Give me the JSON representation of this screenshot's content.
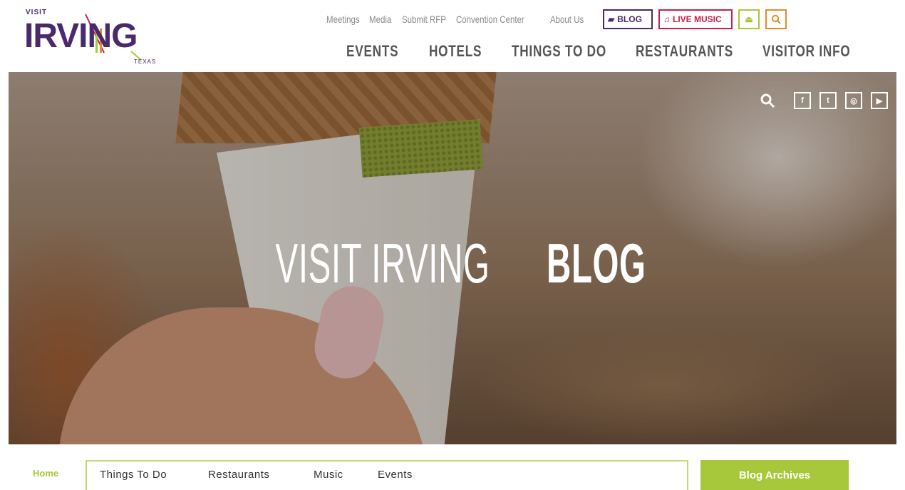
{
  "header": {
    "logo": {
      "visit": "VISIT",
      "word": "IRVING",
      "texas": "TEXAS"
    },
    "utility_links": [
      "Meetings",
      "Media",
      "Submit RFP",
      "Convention Center",
      "About Us"
    ],
    "blog_button": "BLOG",
    "live_music_button": "LIVE MUSIC",
    "main_nav": [
      "EVENTS",
      "HOTELS",
      "THINGS TO DO",
      "RESTAURANTS",
      "VISITOR INFO"
    ],
    "colors": {
      "purple": "#4a2a6b",
      "red": "#c8204b",
      "green": "#a7c83a",
      "orange": "#e98a2a"
    }
  },
  "hero": {
    "title_light": "VISIT IRVING",
    "title_bold": "BLOG",
    "social": [
      "search-icon",
      "facebook-icon",
      "twitter-icon",
      "instagram-icon",
      "youtube-icon"
    ],
    "social_glyphs": {
      "facebook": "f",
      "twitter": "t",
      "instagram": "◎",
      "youtube": "▶"
    }
  },
  "blog_nav": {
    "home": "Home",
    "items": [
      "Things To Do",
      "Restaurants",
      "Music",
      "Events"
    ],
    "archives": "Blog Archives"
  }
}
